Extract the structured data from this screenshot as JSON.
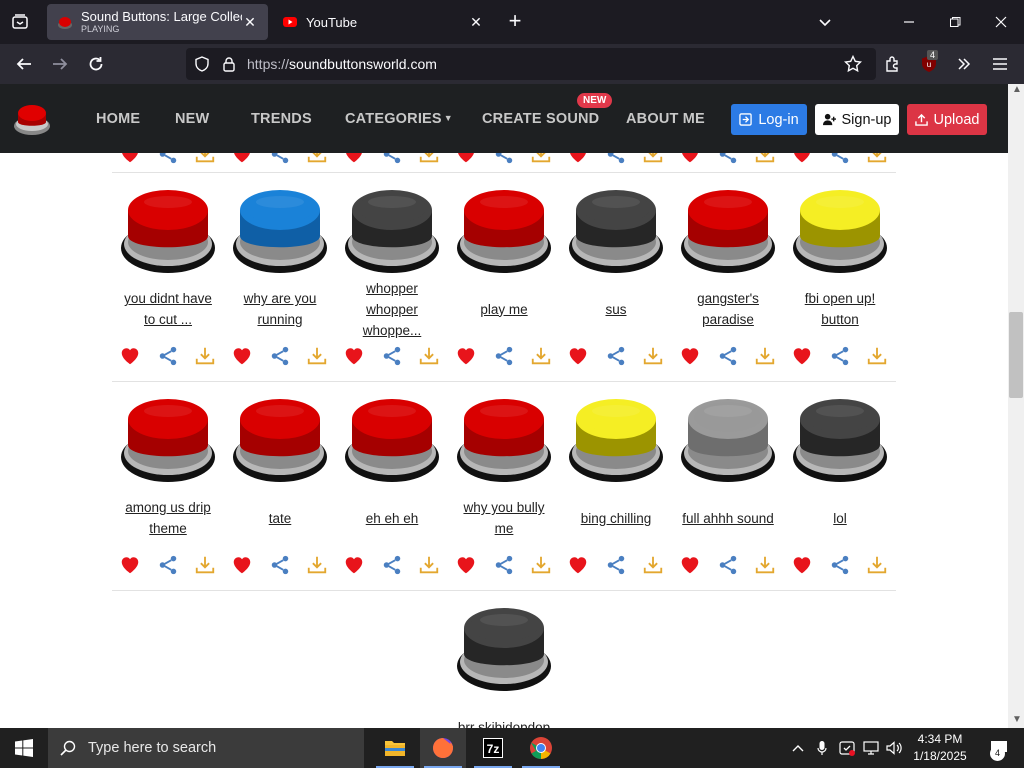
{
  "browser": {
    "tabs": [
      {
        "title": "Sound Buttons: Large Collection",
        "subtitle": "PLAYING",
        "active": true
      },
      {
        "title": "YouTube",
        "subtitle": "",
        "active": false
      }
    ],
    "url_protocol": "https://",
    "url_host": "soundbuttonsworld.com",
    "extension_badge": "4"
  },
  "site": {
    "nav": [
      "HOME",
      "NEW",
      "TRENDS",
      "CATEGORIES",
      "CREATE SOUND",
      "ABOUT ME"
    ],
    "new_badge": "NEW",
    "login": "Log-in",
    "signup": "Sign-up",
    "upload": "Upload"
  },
  "colors": {
    "red": "#d90000",
    "blue": "#1a82d8",
    "dark": "#444444",
    "yellow": "#f5ee24",
    "gray": "#9a9a9a",
    "heart": "#e8141b",
    "share": "#4a7fc1",
    "download": "#e3a72f"
  },
  "rows": [
    [
      {
        "label": "you didnt have to cut ...",
        "color": "red"
      },
      {
        "label": "why are you running",
        "color": "blue"
      },
      {
        "label": "whopper whopper whoppe...",
        "color": "dark"
      },
      {
        "label": "play me",
        "color": "red"
      },
      {
        "label": "sus",
        "color": "dark"
      },
      {
        "label": "gangster's paradise",
        "color": "red"
      },
      {
        "label": "fbi open up! button",
        "color": "yellow"
      }
    ],
    [
      {
        "label": "among us drip theme",
        "color": "red"
      },
      {
        "label": "tate",
        "color": "red"
      },
      {
        "label": "eh eh eh",
        "color": "red"
      },
      {
        "label": "why you bully me",
        "color": "red"
      },
      {
        "label": "bing chilling",
        "color": "yellow"
      },
      {
        "label": "full ahhh sound",
        "color": "gray"
      },
      {
        "label": "lol",
        "color": "dark"
      }
    ],
    [
      {
        "label": "brr skibidopdop",
        "color": "dark"
      }
    ]
  ],
  "taskbar": {
    "search_placeholder": "Type here to search",
    "time": "4:34 PM",
    "date": "1/18/2025",
    "notifications": "4",
    "apps": [
      "file-explorer",
      "firefox",
      "7zip",
      "chrome"
    ]
  }
}
